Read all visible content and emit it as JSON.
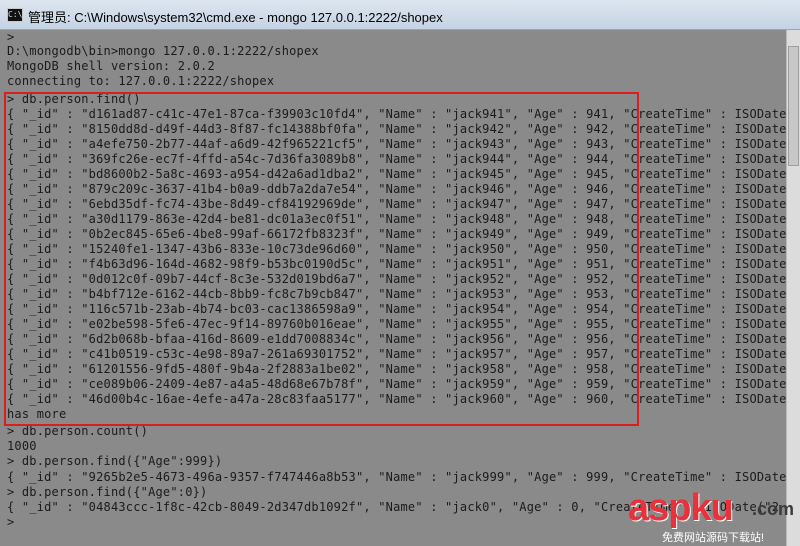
{
  "window": {
    "icon_label": "C:\\",
    "title": "管理员: C:\\Windows\\system32\\cmd.exe - mongo  127.0.0.1:2222/shopex"
  },
  "console": {
    "lines": [
      ">",
      "D:\\mongodb\\bin>mongo 127.0.0.1:2222/shopex",
      "MongoDB shell version: 2.0.2",
      "connecting to: 127.0.0.1:2222/shopex",
      "> db.person.find()",
      "{ \"_id\" : \"d161ad87-c41c-47e1-87ca-f39903c10fd4\", \"Name\" : \"jack941\", \"Age\" : 941, \"CreateTime\" : ISODate",
      "{ \"_id\" : \"8150dd8d-d49f-44d3-8f87-fc14388bf0fa\", \"Name\" : \"jack942\", \"Age\" : 942, \"CreateTime\" : ISODate",
      "{ \"_id\" : \"a4efe750-2b77-44af-a6d9-42f965221cf5\", \"Name\" : \"jack943\", \"Age\" : 943, \"CreateTime\" : ISODate",
      "{ \"_id\" : \"369fc26e-ec7f-4ffd-a54c-7d36fa3089b8\", \"Name\" : \"jack944\", \"Age\" : 944, \"CreateTime\" : ISODate",
      "{ \"_id\" : \"bd8600b2-5a8c-4693-a954-d42a6ad1dba2\", \"Name\" : \"jack945\", \"Age\" : 945, \"CreateTime\" : ISODate",
      "{ \"_id\" : \"879c209c-3637-41b4-b0a9-ddb7a2da7e54\", \"Name\" : \"jack946\", \"Age\" : 946, \"CreateTime\" : ISODate",
      "{ \"_id\" : \"6ebd35df-fc74-43be-8d49-cf84192969de\", \"Name\" : \"jack947\", \"Age\" : 947, \"CreateTime\" : ISODate",
      "{ \"_id\" : \"a30d1179-863e-42d4-be81-dc01a3ec0f51\", \"Name\" : \"jack948\", \"Age\" : 948, \"CreateTime\" : ISODate",
      "{ \"_id\" : \"0b2ec845-65e6-4be8-99af-66172fb8323f\", \"Name\" : \"jack949\", \"Age\" : 949, \"CreateTime\" : ISODate",
      "{ \"_id\" : \"15240fe1-1347-43b6-833e-10c73de96d60\", \"Name\" : \"jack950\", \"Age\" : 950, \"CreateTime\" : ISODate",
      "{ \"_id\" : \"f4b63d96-164d-4682-98f9-b53bc0190d5c\", \"Name\" : \"jack951\", \"Age\" : 951, \"CreateTime\" : ISODate",
      "{ \"_id\" : \"0d012c0f-09b7-44cf-8c3e-532d019bd6a7\", \"Name\" : \"jack952\", \"Age\" : 952, \"CreateTime\" : ISODate",
      "{ \"_id\" : \"b4bf712e-6162-44cb-8bb9-fc8c7b9cb847\", \"Name\" : \"jack953\", \"Age\" : 953, \"CreateTime\" : ISODate",
      "{ \"_id\" : \"116c571b-23ab-4b74-bc03-cac1386598a9\", \"Name\" : \"jack954\", \"Age\" : 954, \"CreateTime\" : ISODate",
      "{ \"_id\" : \"e02be598-5fe6-47ec-9f14-89760b016eae\", \"Name\" : \"jack955\", \"Age\" : 955, \"CreateTime\" : ISODate",
      "{ \"_id\" : \"6d2b068b-bfaa-416d-8609-e1dd7008834c\", \"Name\" : \"jack956\", \"Age\" : 956, \"CreateTime\" : ISODate",
      "{ \"_id\" : \"c41b0519-c53c-4e98-89a7-261a69301752\", \"Name\" : \"jack957\", \"Age\" : 957, \"CreateTime\" : ISODate",
      "{ \"_id\" : \"61201556-9fd5-480f-9b4a-2f2883a1be02\", \"Name\" : \"jack958\", \"Age\" : 958, \"CreateTime\" : ISODate",
      "{ \"_id\" : \"ce089b06-2409-4e87-a4a5-48d68e67b78f\", \"Name\" : \"jack959\", \"Age\" : 959, \"CreateTime\" : ISODate",
      "{ \"_id\" : \"46d00b4c-16ae-4efe-a47a-28c83faa5177\", \"Name\" : \"jack960\", \"Age\" : 960, \"CreateTime\" : ISODate",
      "has more",
      "> db.person.count()",
      "1000",
      "> db.person.find({\"Age\":999})",
      "{ \"_id\" : \"9265b2e5-4673-496a-9357-f747446a8b53\", \"Name\" : \"jack999\", \"Age\" : 999, \"CreateTime\" : ISODate",
      "> db.person.find({\"Age\":0})",
      "{ \"_id\" : \"04843ccc-1f8c-42cb-8049-2d347db1092f\", \"Name\" : \"jack0\", \"Age\" : 0, \"CreateTime\" : ISODate(\"2",
      ">"
    ]
  },
  "watermark": {
    "main": "aspku",
    "tld": ".com",
    "sub": "免费网站源码下载站!"
  },
  "colors": {
    "console_bg": "#8a8a8a",
    "console_text": "#1b1b1b",
    "highlight_box": "#d81e1e",
    "watermark": "#e8313a"
  }
}
